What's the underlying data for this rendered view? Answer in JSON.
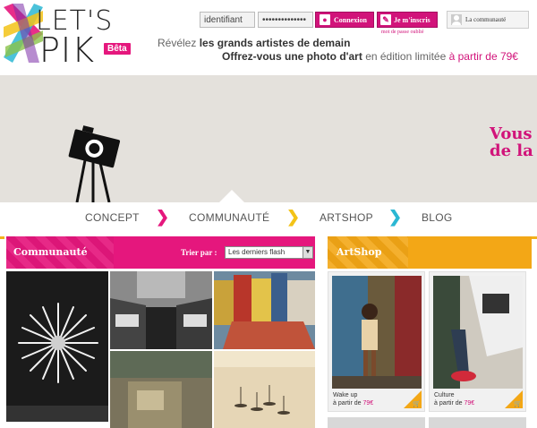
{
  "brand": {
    "line1": "LET'S",
    "line2": "PIK",
    "badge": "Bêta"
  },
  "login": {
    "username_value": "identifiant",
    "password_value": "••••••••••••••",
    "connect_label": "Connexion",
    "signup_label": "Je m'inscris",
    "forgot_label": "mot de passe oublié",
    "community_label": "La communauté"
  },
  "tagline": {
    "line1_prefix": "Révélez ",
    "line1_bold": "les grands artistes de demain",
    "line2_bold": "Offrez-vous une photo d'art",
    "line2_mid": " en édition limitée ",
    "line2_price": "à partir de 79€"
  },
  "hero": {
    "text_line1": "Vous",
    "text_line2": "de la"
  },
  "nav": {
    "items": [
      "CONCEPT",
      "COMMUNAUTÉ",
      "ARTSHOP",
      "BLOG"
    ],
    "separators_colors": [
      "#e5177d",
      "#f3c317",
      "#2bb7d3"
    ]
  },
  "community": {
    "title": "Communauté",
    "sort_label": "Trier par :",
    "sort_value": "Les derniers flash"
  },
  "artshop": {
    "title": "ArtShop",
    "items": [
      {
        "name": "Wake up",
        "price_prefix": "à partir de ",
        "price": "79€"
      },
      {
        "name": "Culture",
        "price_prefix": "à partir de ",
        "price": "79€"
      }
    ]
  },
  "colors": {
    "pink": "#e5177d",
    "orange": "#f3a716",
    "cyan": "#2bb7d3",
    "yellow": "#f3c317"
  }
}
